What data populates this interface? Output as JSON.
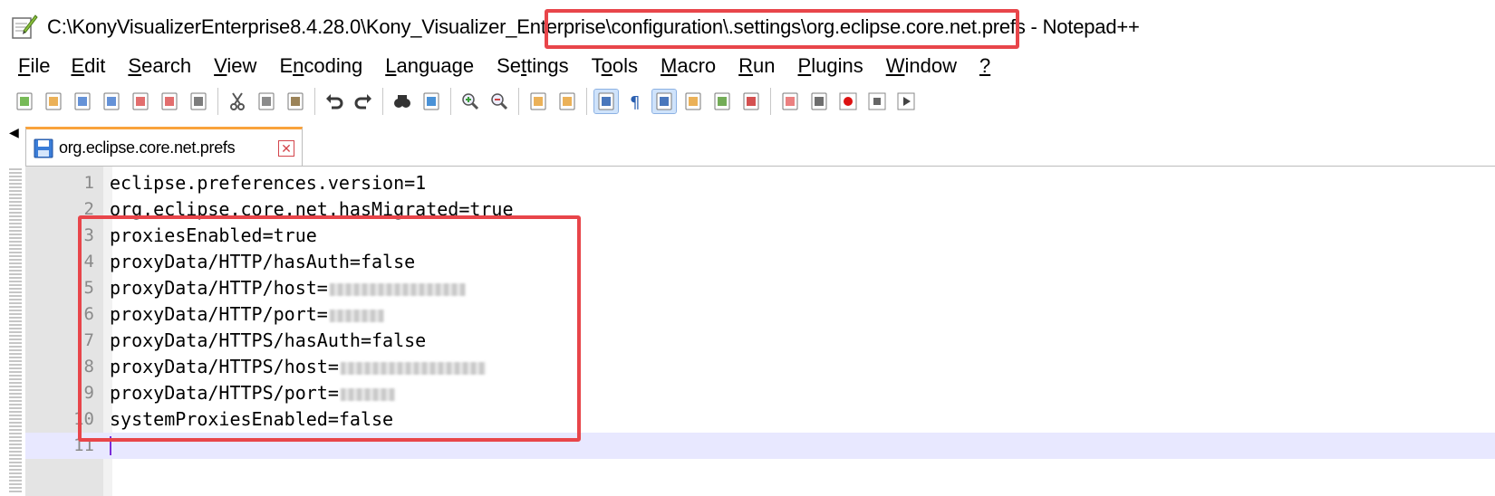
{
  "window": {
    "title": "C:\\KonyVisualizerEnterprise8.4.28.0\\Kony_Visualizer_Enterprise\\configuration\\.settings\\org.eclipse.core.net.prefs - Notepad++"
  },
  "menu": [
    {
      "label": "File",
      "key": "F",
      "rest": "ile"
    },
    {
      "label": "Edit",
      "key": "E",
      "rest": "dit"
    },
    {
      "label": "Search",
      "key": "S",
      "rest": "earch"
    },
    {
      "label": "View",
      "key": "V",
      "rest": "iew"
    },
    {
      "label": "Encoding",
      "pre": "E",
      "key": "n",
      "rest": "coding"
    },
    {
      "label": "Language",
      "key": "L",
      "rest": "anguage"
    },
    {
      "label": "Settings",
      "pre": "Se",
      "key": "t",
      "rest": "tings"
    },
    {
      "label": "Tools",
      "pre": "T",
      "key": "o",
      "rest": "ols"
    },
    {
      "label": "Macro",
      "key": "M",
      "rest": "acro"
    },
    {
      "label": "Run",
      "key": "R",
      "rest": "un"
    },
    {
      "label": "Plugins",
      "key": "P",
      "rest": "lugins"
    },
    {
      "label": "Window",
      "key": "W",
      "rest": "indow"
    },
    {
      "label": "?",
      "key": "?",
      "rest": ""
    }
  ],
  "toolbar_icons": [
    "new-file-icon",
    "open-file-icon",
    "save-icon",
    "save-all-icon",
    "close-icon",
    "close-all-icon",
    "print-icon",
    "cut-icon",
    "copy-icon",
    "paste-icon",
    "undo-icon",
    "redo-icon",
    "find-icon",
    "replace-icon",
    "zoom-in-icon",
    "zoom-out-icon",
    "sync-vertical-icon",
    "sync-horizontal-icon",
    "word-wrap-icon",
    "show-all-chars-icon",
    "indent-guide-icon",
    "udl-icon",
    "doc-map-icon",
    "function-list-icon",
    "folder-workspace-icon",
    "monitoring-icon",
    "record-macro-icon",
    "stop-record-icon",
    "play-macro-icon",
    "run-macro-multiple-icon",
    "save-macro-icon"
  ],
  "tab": {
    "label": "org.eclipse.core.net.prefs"
  },
  "editor": {
    "lines": [
      {
        "num": "1",
        "text": "eclipse.preferences.version=1"
      },
      {
        "num": "2",
        "text": "org.eclipse.core.net.hasMigrated=true"
      },
      {
        "num": "3",
        "text": "proxiesEnabled=true"
      },
      {
        "num": "4",
        "text": "proxyData/HTTP/hasAuth=false"
      },
      {
        "num": "5",
        "text": "proxyData/HTTP/host="
      },
      {
        "num": "6",
        "text": "proxyData/HTTP/port="
      },
      {
        "num": "7",
        "text": "proxyData/HTTPS/hasAuth=false"
      },
      {
        "num": "8",
        "text": "proxyData/HTTPS/host="
      },
      {
        "num": "9",
        "text": "proxyData/HTTPS/port="
      },
      {
        "num": "10",
        "text": "systemProxiesEnabled=false"
      },
      {
        "num": "11",
        "text": ""
      }
    ]
  },
  "colors": {
    "highlight_box": "#e8454a",
    "current_line": "#e8e8ff",
    "tab_accent": "#f9a33c"
  }
}
